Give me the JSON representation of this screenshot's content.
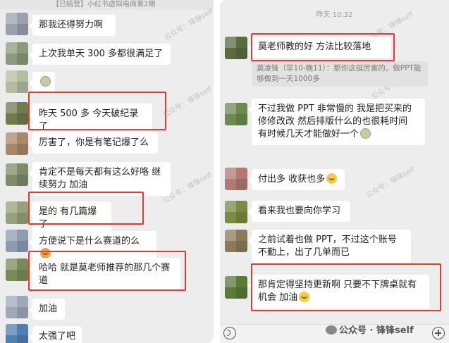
{
  "left_panel": {
    "header_text": "【已结营】小红书虚拟电商第2期",
    "watermark": "公众号：锋锋self",
    "messages": [
      {
        "text": "那我还得努力啊",
        "avatar_color": "#9aa0ae"
      },
      {
        "text": "上次我单天 300 多都很满足了",
        "avatar_color": "#8a9a7a"
      },
      {
        "text": "",
        "avatar_color": "#b6bca0"
      },
      {
        "text": "昨天 500 多  今天破纪录了",
        "avatar_color": "#6f7a4e"
      },
      {
        "text": "厉害了，你是有笔记爆了么",
        "avatar_color": "#a88868"
      },
      {
        "text": "肯定不是每天都有这么好咯  继续努力  加油",
        "avatar_color": "#7f8a6a"
      },
      {
        "text": "是的  有几篇爆了",
        "avatar_color": "#96a07a"
      },
      {
        "text": "方便说下是什么赛道的么",
        "avatar_color": "#8f9bb0"
      },
      {
        "text": "哈哈  就是莫老师推荐的那几个赛道",
        "avatar_color": "#7a8b5a"
      },
      {
        "text": "加油",
        "avatar_color": "#a0a8b8"
      },
      {
        "text": "太强了吧",
        "avatar_color": "#4f7fb0"
      }
    ]
  },
  "right_panel": {
    "timestamp": "昨天 10:32",
    "watermark": "公众号：锋锋self",
    "messages": [
      {
        "text": "莫老师教的好  方法比较落地",
        "avatar_color": "#5a6b40",
        "quote": "莫凌锋（早10-晚11）：那你这挺厉害的，做PPT能够做到一天1000多"
      },
      {
        "text": "不过我做 PPT 非常慢的  我是把买来的修修改改  然后排版什么的也很耗时间  有时候几天才能做好一个",
        "avatar_color": "#6a8a50"
      },
      {
        "text": "付出多  收获也多",
        "avatar_color": "#b07a70"
      },
      {
        "text": "看来我也要向你学习",
        "avatar_color": "#7a8a40"
      },
      {
        "text": "之前试着也做 PPT，不过这个账号不勤上，出了几单而已",
        "avatar_color": "#8a7a5a"
      },
      {
        "text": "那肯定得坚持更新啊   只要不下牌桌就有机会  加油",
        "avatar_color": "#5a7a3a"
      }
    ],
    "brand": "公众号 · 锋锋self"
  },
  "colors": {
    "highlight": "#e53935",
    "chat_bg": "#ededed",
    "bubble": "#ffffff"
  }
}
